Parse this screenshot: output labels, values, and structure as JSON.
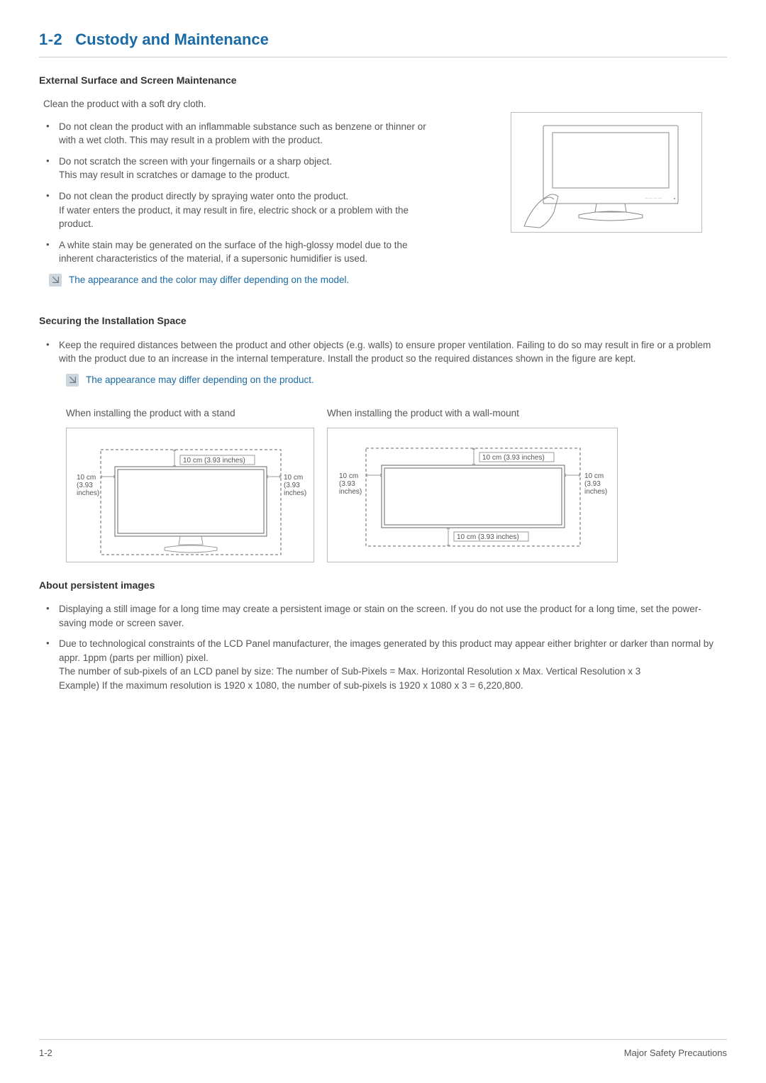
{
  "header": {
    "number": "1-2",
    "title": "Custody and Maintenance"
  },
  "ext": {
    "heading": "External Surface and Screen Maintenance",
    "intro": "Clean the product with a soft dry cloth.",
    "items": [
      {
        "main": "Do not clean the product with an inflammable substance such as benzene or thinner or with a wet cloth. This may result in a problem with the product."
      },
      {
        "main": "Do not scratch the screen with your fingernails or a sharp object.",
        "sub": "This may result in scratches or damage to the product."
      },
      {
        "main": "Do not clean the product directly by spraying water onto the product.",
        "sub": "If water enters the product, it may result in fire, electric shock or a problem with the product."
      },
      {
        "main": "A white stain may be generated on the surface of the high-glossy model due to the inherent characteristics of the material, if a supersonic humidifier is used."
      }
    ],
    "note": "The appearance and the color may differ depending on the model."
  },
  "space": {
    "heading": "Securing the Installation Space",
    "bullet": "Keep the required distances between the product and other objects (e.g. walls) to ensure proper ventilation. Failing to do so may result in fire or a problem with the product due to an increase in the internal temperature. Install the product so the required distances shown in the figure are kept.",
    "note": "The appearance may differ depending on the product.",
    "figA": {
      "caption": "When installing the product with a stand"
    },
    "figB": {
      "caption": "When installing the product with a wall-mount"
    },
    "labels": {
      "top": "10 cm (3.93 inches)",
      "side": "10 cm\n(3.93\ninches)",
      "bottom": "10 cm (3.93 inches)"
    }
  },
  "persist": {
    "heading": "About persistent images",
    "items": [
      "Displaying a still image for a long time may create a persistent image or stain on the screen. If you do not use the product for a long time, set the power-saving mode or screen saver.",
      "Due to technological constraints of the LCD Panel manufacturer, the images generated by this product may appear either brighter or darker than normal by appr. 1ppm (parts per million) pixel.\nThe number of sub-pixels of an LCD panel by size:  The number of Sub-Pixels = Max. Horizontal Resolution x Max. Vertical Resolution x 3\nExample) If the maximum resolution is 1920 x 1080, the number of sub-pixels is 1920 x 1080 x 3 = 6,220,800."
    ]
  },
  "footer": {
    "left": "1-2",
    "right": "Major Safety Precautions"
  }
}
